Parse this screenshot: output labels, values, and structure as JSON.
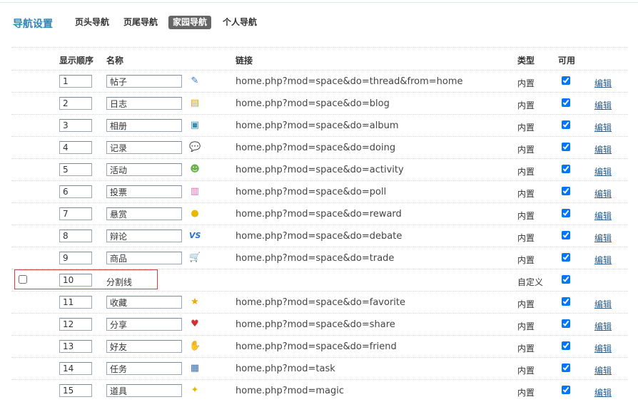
{
  "header": {
    "title": "导航设置",
    "tabs": [
      "页头导航",
      "页尾导航",
      "家园导航",
      "个人导航"
    ],
    "active_tab": "家园导航"
  },
  "columns": {
    "order": "显示顺序",
    "name": "名称",
    "link": "链接",
    "type": "类型",
    "enabled": "可用"
  },
  "edit_label": "编辑",
  "rows": [
    {
      "order": "1",
      "name": "帖子",
      "icon": "thread-icon",
      "link": "home.php?mod=space&do=thread&from=home",
      "type": "内置",
      "enabled": true
    },
    {
      "order": "2",
      "name": "日志",
      "icon": "blog-icon",
      "link": "home.php?mod=space&do=blog",
      "type": "内置",
      "enabled": true
    },
    {
      "order": "3",
      "name": "相册",
      "icon": "album-icon",
      "link": "home.php?mod=space&do=album",
      "type": "内置",
      "enabled": true
    },
    {
      "order": "4",
      "name": "记录",
      "icon": "doing-icon",
      "link": "home.php?mod=space&do=doing",
      "type": "内置",
      "enabled": true
    },
    {
      "order": "5",
      "name": "活动",
      "icon": "activity-icon",
      "link": "home.php?mod=space&do=activity",
      "type": "内置",
      "enabled": true
    },
    {
      "order": "6",
      "name": "投票",
      "icon": "poll-icon",
      "link": "home.php?mod=space&do=poll",
      "type": "内置",
      "enabled": true
    },
    {
      "order": "7",
      "name": "悬赏",
      "icon": "reward-icon",
      "link": "home.php?mod=space&do=reward",
      "type": "内置",
      "enabled": true
    },
    {
      "order": "8",
      "name": "辩论",
      "icon": "debate-icon",
      "link": "home.php?mod=space&do=debate",
      "type": "内置",
      "enabled": true
    },
    {
      "order": "9",
      "name": "商品",
      "icon": "trade-icon",
      "link": "home.php?mod=space&do=trade",
      "type": "内置",
      "enabled": true
    },
    {
      "order": "10",
      "name": "分割线",
      "icon": "",
      "link": "",
      "type": "自定义",
      "enabled": true,
      "separator": true
    },
    {
      "order": "11",
      "name": "收藏",
      "icon": "favorite-icon",
      "link": "home.php?mod=space&do=favorite",
      "type": "内置",
      "enabled": true
    },
    {
      "order": "12",
      "name": "分享",
      "icon": "share-icon",
      "link": "home.php?mod=space&do=share",
      "type": "内置",
      "enabled": true
    },
    {
      "order": "13",
      "name": "好友",
      "icon": "friend-icon",
      "link": "home.php?mod=space&do=friend",
      "type": "内置",
      "enabled": true
    },
    {
      "order": "14",
      "name": "任务",
      "icon": "task-icon",
      "link": "home.php?mod=task",
      "type": "内置",
      "enabled": true
    },
    {
      "order": "15",
      "name": "道具",
      "icon": "magic-icon",
      "link": "home.php?mod=magic",
      "type": "内置",
      "enabled": true
    }
  ]
}
